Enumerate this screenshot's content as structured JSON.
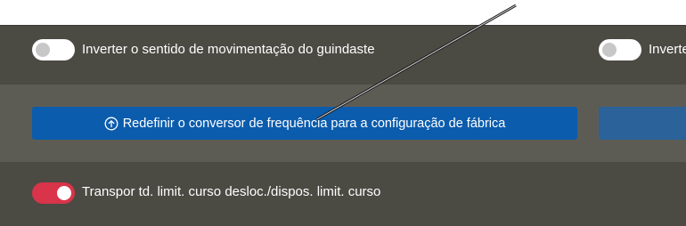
{
  "settings": {
    "invert_crane_direction": {
      "label": "Inverter o sentido de movimentação do guindaste",
      "enabled": false
    },
    "invert_partial": {
      "label": "Inverte",
      "enabled": false
    },
    "reset_button": {
      "label": "Redefinir o conversor de frequência para a configuração de fábrica",
      "icon": "upload-circle-icon"
    },
    "limit_switch_override": {
      "label": "Transpor td. limit. curso desloc./dispos. limit. curso",
      "enabled": true
    }
  },
  "colors": {
    "primary_button": "#0b5cad",
    "toggle_on": "#d9344a",
    "toggle_off": "#ffffff"
  }
}
